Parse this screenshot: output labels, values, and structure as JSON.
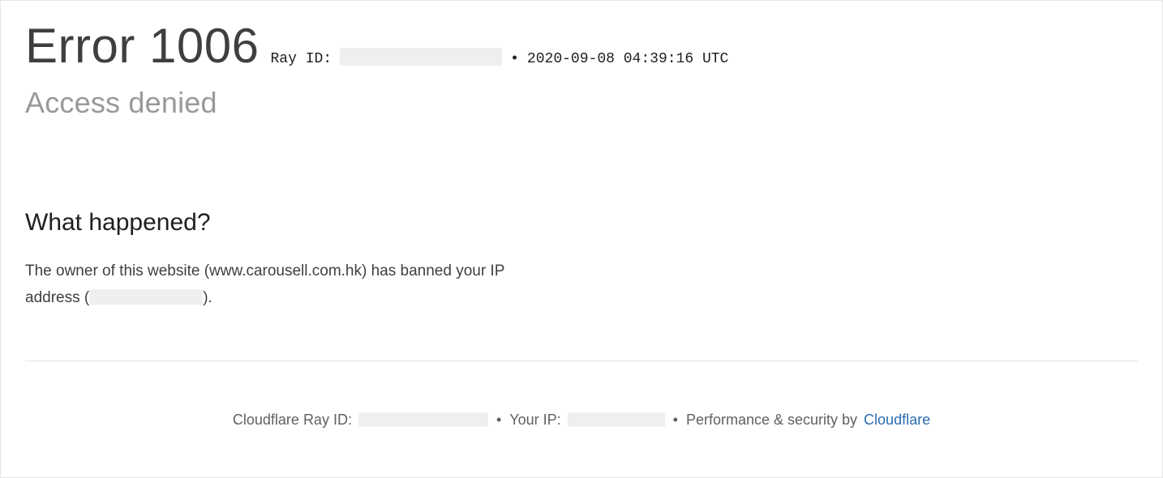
{
  "header": {
    "error_title": "Error 1006",
    "ray_label": "Ray ID:",
    "timestamp": "2020-09-08 04:39:16 UTC"
  },
  "subheading": "Access denied",
  "section": {
    "heading": "What happened?",
    "body_prefix": "The owner of this website (www.carousell.com.hk) has banned your IP address (",
    "body_suffix": ")."
  },
  "footer": {
    "ray_label": "Cloudflare Ray ID:",
    "ip_label": "Your IP:",
    "perf_label": "Performance & security by",
    "cloudflare": "Cloudflare",
    "sep": "•"
  }
}
